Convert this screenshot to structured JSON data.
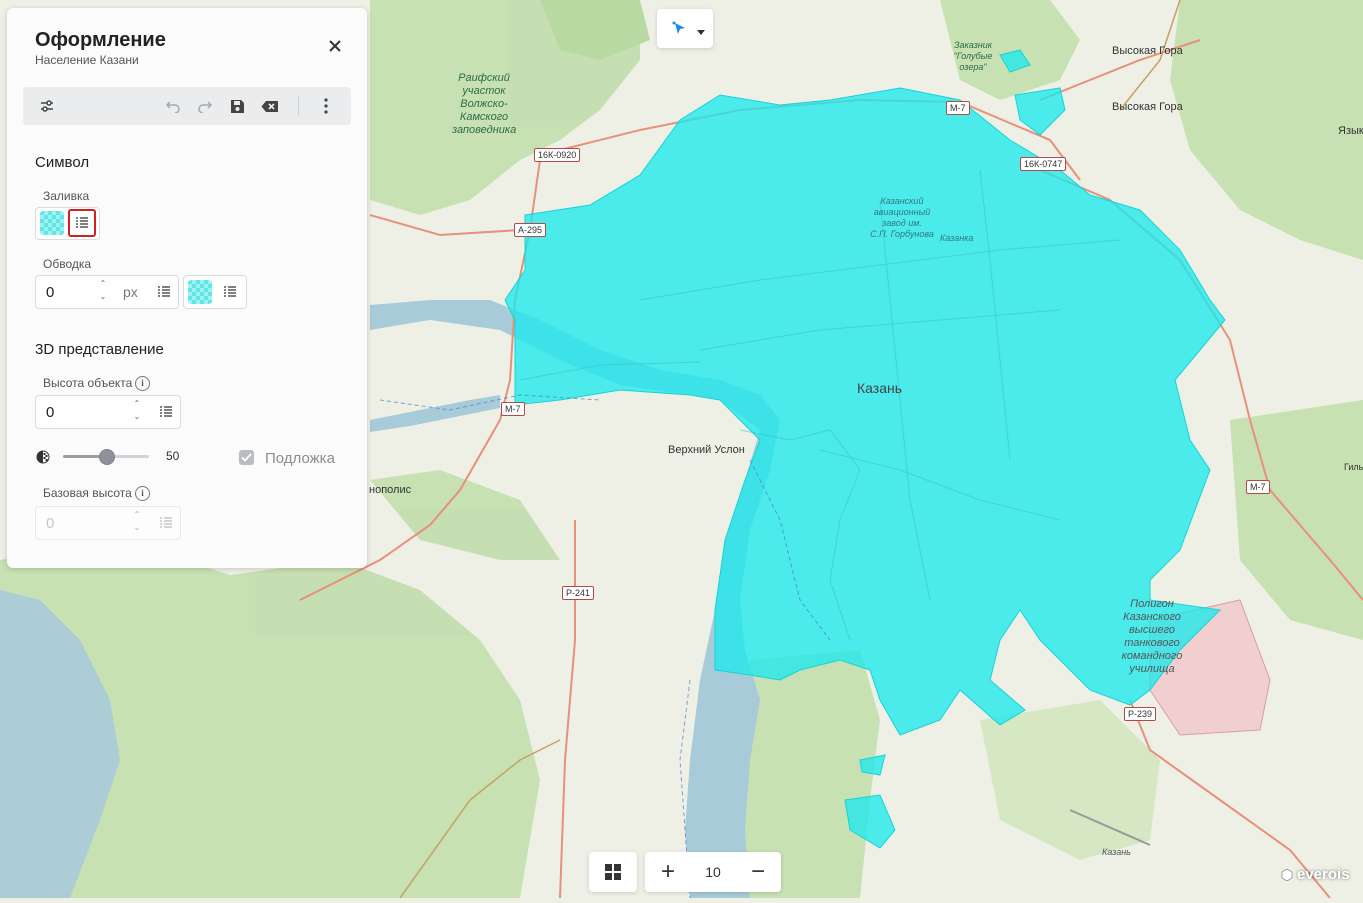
{
  "map": {
    "labels": {
      "kazan_city": "Казань",
      "verkhny_uslon": "Верхний Услон",
      "vysokaya_gora_1": "Высокая Гора",
      "vysokaya_gora_2": "Высокая Гора",
      "nopolis": "нополис",
      "raifa": "Раифский\nучасток\nВолжско-\nКамского\nзаповедника",
      "zakaznik": "Заказник\n\"Голубые\nозера\"",
      "aviation_plant": "Казанский\nавиационный\nзавод им.\nС.П. Горбунова",
      "kazanka": "Казанка",
      "polygon": "Полигон\nКазанского\nвысшего\nтанкового\nкомандного\nучилища",
      "airport": "Казань",
      "yazyk": "Языки",
      "gil": "Гиль"
    },
    "shields": {
      "m7_top": "М-7",
      "r16k0920": "16К-0920",
      "r16k0747": "16К-0747",
      "a295": "А-295",
      "m7_left": "М-7",
      "m7_right": "М-7",
      "r241": "Р-241",
      "r239": "Р-239"
    },
    "colors": {
      "background": "#eef0e6",
      "forest": "#c4dfb0",
      "water": "#a8cbd9",
      "population_fill": "#1ee8ec",
      "restricted": "#f2cfcf"
    }
  },
  "panel": {
    "title": "Оформление",
    "subtitle": "Население Казани",
    "toolbar": {
      "settings": "sliders-icon",
      "undo": "undo-icon",
      "redo": "redo-icon",
      "save": "save-icon",
      "clear": "clear-icon",
      "more": "more-vertical-icon"
    },
    "symbol": {
      "section_title": "Символ",
      "fill_label": "Заливка",
      "stroke_label": "Обводка",
      "stroke_width": "0",
      "stroke_unit": "px"
    },
    "view3d": {
      "section_title": "3D представление",
      "height_label": "Высота объекта",
      "height_value": "0",
      "opacity_value": "50",
      "opacity_fraction": 0.5,
      "backdrop_label": "Подложка",
      "backdrop_checked": true,
      "base_height_label": "Базовая высота",
      "base_height_value": "0"
    }
  },
  "zoom": {
    "level": "10",
    "plus": "+",
    "minus": "−"
  },
  "brand": "everois"
}
